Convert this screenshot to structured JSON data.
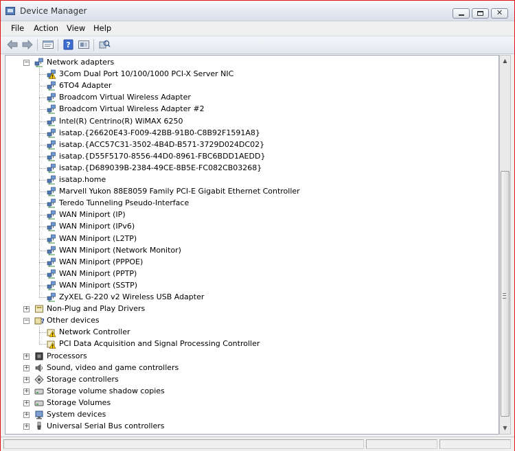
{
  "window": {
    "title": "Device Manager",
    "close_glyph": "✕"
  },
  "menu": [
    "File",
    "Action",
    "View",
    "Help"
  ],
  "toolbar": {
    "icons": [
      "back-arrow-icon",
      "forward-arrow-icon",
      "properties-icon",
      "help-icon",
      "update-driver-icon",
      "scan-hardware-icon"
    ]
  },
  "tree": {
    "network_adapters": {
      "label": "Network adapters",
      "children": [
        {
          "label": "3Com Dual Port 10/100/1000 PCI-X Server NIC",
          "warn": true
        },
        {
          "label": "6TO4 Adapter",
          "warn": false
        },
        {
          "label": "Broadcom Virtual Wireless Adapter",
          "warn": false
        },
        {
          "label": "Broadcom Virtual Wireless Adapter #2",
          "warn": false
        },
        {
          "label": "Intel(R) Centrino(R) WiMAX 6250",
          "warn": false
        },
        {
          "label": "isatap.{26620E43-F009-42BB-91B0-C8B92F1591A8}",
          "warn": false
        },
        {
          "label": "isatap.{ACC57C31-3502-4B4D-B571-3729D024DC02}",
          "warn": false
        },
        {
          "label": "isatap.{D55F5170-8556-44D0-8961-FBC6BDD1AEDD}",
          "warn": false
        },
        {
          "label": "isatap.{D689039B-2384-49CE-8B5E-FC082CB03268}",
          "warn": false
        },
        {
          "label": "isatap.home",
          "warn": false
        },
        {
          "label": "Marvell Yukon 88E8059 Family PCI-E Gigabit Ethernet Controller",
          "warn": false
        },
        {
          "label": "Teredo Tunneling Pseudo-Interface",
          "warn": false
        },
        {
          "label": "WAN Miniport (IP)",
          "warn": false
        },
        {
          "label": "WAN Miniport (IPv6)",
          "warn": false
        },
        {
          "label": "WAN Miniport (L2TP)",
          "warn": false
        },
        {
          "label": "WAN Miniport (Network Monitor)",
          "warn": false
        },
        {
          "label": "WAN Miniport (PPPOE)",
          "warn": false
        },
        {
          "label": "WAN Miniport (PPTP)",
          "warn": false
        },
        {
          "label": "WAN Miniport (SSTP)",
          "warn": false
        },
        {
          "label": "ZyXEL G-220 v2 Wireless USB Adapter",
          "warn": false
        }
      ]
    },
    "non_plug": {
      "label": "Non-Plug and Play Drivers"
    },
    "other_devices": {
      "label": "Other devices",
      "children": [
        {
          "label": "Network Controller",
          "warn": true
        },
        {
          "label": "PCI Data Acquisition and Signal Processing Controller",
          "warn": true
        }
      ]
    },
    "categories": [
      {
        "label": "Processors",
        "icon": "processor-icon"
      },
      {
        "label": "Sound, video and game controllers",
        "icon": "speaker-icon"
      },
      {
        "label": "Storage controllers",
        "icon": "storage-controller-icon"
      },
      {
        "label": "Storage volume shadow copies",
        "icon": "disk-drive-icon"
      },
      {
        "label": "Storage Volumes",
        "icon": "disk-drive-icon"
      },
      {
        "label": "System devices",
        "icon": "system-devices-icon"
      },
      {
        "label": "Universal Serial Bus controllers",
        "icon": "usb-icon"
      }
    ],
    "expand_glyph": "+",
    "collapse_glyph": "−"
  },
  "colors": {
    "window_border": "#e01010",
    "selection_accent": "#2b5797",
    "warning": "#f2c200"
  }
}
